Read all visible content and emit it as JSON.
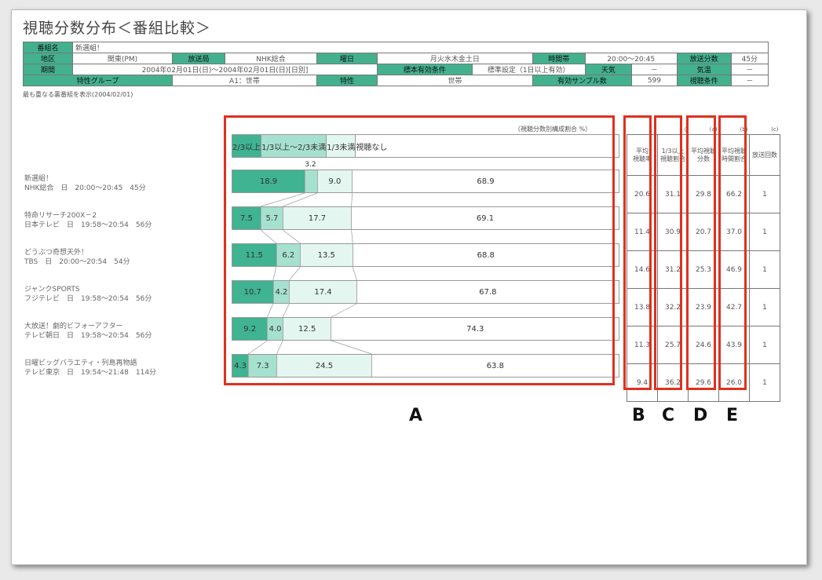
{
  "title": "視聴分数分布＜番組比較＞",
  "header": {
    "row1": {
      "program_label": "番組名",
      "program": "新選組！"
    },
    "row2": {
      "region_label": "地区",
      "region": "関東(PM)",
      "station_label": "放送局",
      "station": "NHK総合",
      "weekday_label": "曜日",
      "weekday": "月火水木金土日",
      "time_label": "時間帯",
      "time": "20:00～20:45",
      "duration_label": "放送分数",
      "duration": "45分"
    },
    "row3": {
      "period_label": "期間",
      "period": "2004年02月01日(日)～2004年02月01日(日)[日別]",
      "sample_cond_label": "標本有効条件",
      "sample_cond": "標準設定（1日以上有効）",
      "weather_label": "天気",
      "weather": "－",
      "temp_label": "気温",
      "temp": "－"
    },
    "row4": {
      "group_label": "特性グループ",
      "group": "A1：世帯",
      "attr_label": "特性",
      "attr": "世帯",
      "sample_label": "有効サンプル数",
      "sample": "599",
      "view_cond_label": "視聴条件",
      "view_cond": "－"
    }
  },
  "note": "最も重なる裏番組を表示(2004/02/01)",
  "chart_data": {
    "type": "bar",
    "unit_note": "（視聴分数別構成割合 %）",
    "legend": [
      "2/3以上",
      "1/3以上～2/3未満",
      "1/3未満",
      "視聴なし"
    ],
    "colors": [
      "#3fb392",
      "#a6e1cf",
      "#e3f6f0",
      "#ffffff"
    ],
    "rows": [
      {
        "label1": "新選組！",
        "label2": "NHK総合　日　20:00～20:45　45分",
        "values": [
          18.9,
          3.2,
          9.0,
          68.9
        ],
        "labels": [
          "18.9",
          "3.2",
          "9.0",
          "68.9"
        ]
      },
      {
        "label1": "特命リサーチ200X－2",
        "label2": "日本テレビ　日　19:58～20:54　56分",
        "values": [
          7.5,
          5.7,
          17.7,
          69.1
        ],
        "labels": [
          "7.5",
          "5.7",
          "17.7",
          "69.1"
        ]
      },
      {
        "label1": "どうぶつ奇想天外！",
        "label2": "TBS　日　20:00～20:54　54分",
        "values": [
          11.5,
          6.2,
          13.5,
          68.8
        ],
        "labels": [
          "11.5",
          "6.2",
          "13.5",
          "68.8"
        ]
      },
      {
        "label1": "ジャンクSPORTS",
        "label2": "フジテレビ　日　19:58～20:54　56分",
        "values": [
          10.7,
          4.2,
          17.4,
          67.8
        ],
        "labels": [
          "10.7",
          "4.2",
          "17.4",
          "67.8"
        ]
      },
      {
        "label1": "大放送！劇的ビフォーアフター",
        "label2": "テレビ朝日　日　19:58～20:54　56分",
        "values": [
          9.2,
          4.0,
          12.5,
          74.3
        ],
        "labels": [
          "9.2",
          "4.0",
          "12.5",
          "74.3"
        ]
      },
      {
        "label1": "日曜ビッグバラエティ・列島再物語",
        "label2": "テレビ東京　日　19:54～21:48　114分",
        "values": [
          4.3,
          7.3,
          24.5,
          63.8
        ],
        "labels": [
          "4.3",
          "7.3",
          "24.5",
          "63.8"
        ]
      }
    ]
  },
  "stats": {
    "col_numbers": [
      "(",
      "(",
      "(a)",
      "(b)",
      "(c)"
    ],
    "headers": [
      "平均\n視聴率",
      "1/3以上\n視聴割合",
      "平均視聴\n分数",
      "平均視聴\n時間割合",
      "放送回数"
    ],
    "rows": [
      [
        "20.6",
        "31.1",
        "29.8",
        "66.2",
        "1"
      ],
      [
        "11.4",
        "30.9",
        "20.7",
        "37.0",
        "1"
      ],
      [
        "14.6",
        "31.2",
        "25.3",
        "46.9",
        "1"
      ],
      [
        "13.8",
        "32.2",
        "23.9",
        "42.7",
        "1"
      ],
      [
        "11.3",
        "25.7",
        "24.6",
        "43.9",
        "1"
      ],
      [
        "9.4",
        "36.2",
        "29.6",
        "26.0",
        "1"
      ]
    ]
  },
  "letters": [
    "A",
    "B",
    "C",
    "D",
    "E"
  ]
}
